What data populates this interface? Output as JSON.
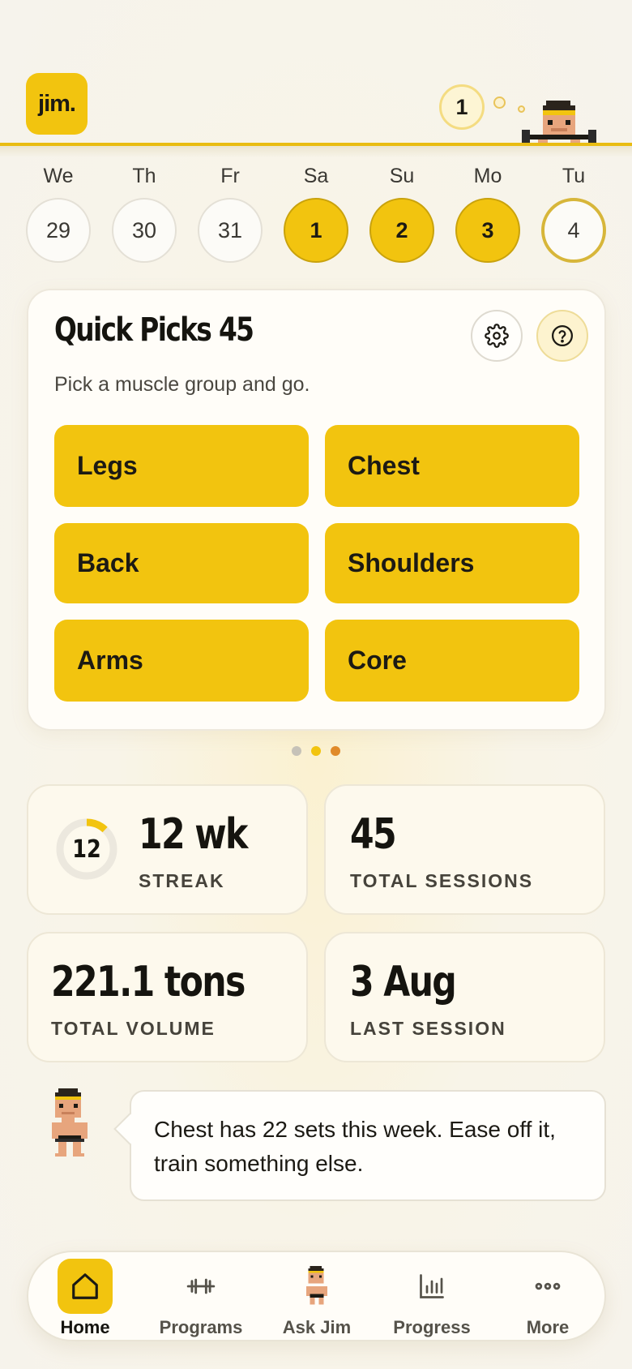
{
  "header": {
    "logo_text": "jim.",
    "notification_count": "1"
  },
  "week": [
    {
      "day": "We",
      "date": "29",
      "state": "none"
    },
    {
      "day": "Th",
      "date": "30",
      "state": "none"
    },
    {
      "day": "Fr",
      "date": "31",
      "state": "none"
    },
    {
      "day": "Sa",
      "date": "1",
      "state": "done"
    },
    {
      "day": "Su",
      "date": "2",
      "state": "done"
    },
    {
      "day": "Mo",
      "date": "3",
      "state": "done"
    },
    {
      "day": "Tu",
      "date": "4",
      "state": "today"
    }
  ],
  "quick_picks": {
    "title": "Quick Picks 45",
    "subtitle": "Pick a muscle group and go.",
    "settings_icon": "gear-icon",
    "help_icon": "question-circle-icon",
    "groups": [
      "Legs",
      "Chest",
      "Back",
      "Shoulders",
      "Arms",
      "Core"
    ]
  },
  "pager": {
    "page_count": 3,
    "active_index": 1,
    "colors": [
      "#c6c2b8",
      "#f2c40f",
      "#e08a2a"
    ]
  },
  "stats": {
    "streak": {
      "ring_value": "12",
      "ring_progress": 0.12,
      "value": "12 wk",
      "label": "STREAK"
    },
    "total_sessions": {
      "value": "45",
      "label": "TOTAL SESSIONS"
    },
    "total_volume": {
      "value": "221.1 tons",
      "label": "TOTAL VOLUME"
    },
    "last_session": {
      "value": "3 Aug",
      "label": "LAST SESSION"
    }
  },
  "coach": {
    "message": "Chest has 22 sets this week. Ease off it, train something else."
  },
  "nav": {
    "items": [
      {
        "label": "Home",
        "icon": "home-icon",
        "active": true
      },
      {
        "label": "Programs",
        "icon": "dumbbell-icon",
        "active": false
      },
      {
        "label": "Ask Jim",
        "icon": "jim-avatar-icon",
        "active": false
      },
      {
        "label": "Progress",
        "icon": "bar-chart-icon",
        "active": false
      },
      {
        "label": "More",
        "icon": "more-dots-icon",
        "active": false
      }
    ]
  },
  "colors": {
    "accent": "#f2c40f",
    "background": "#f6f3ec",
    "text": "#1c1a14"
  }
}
